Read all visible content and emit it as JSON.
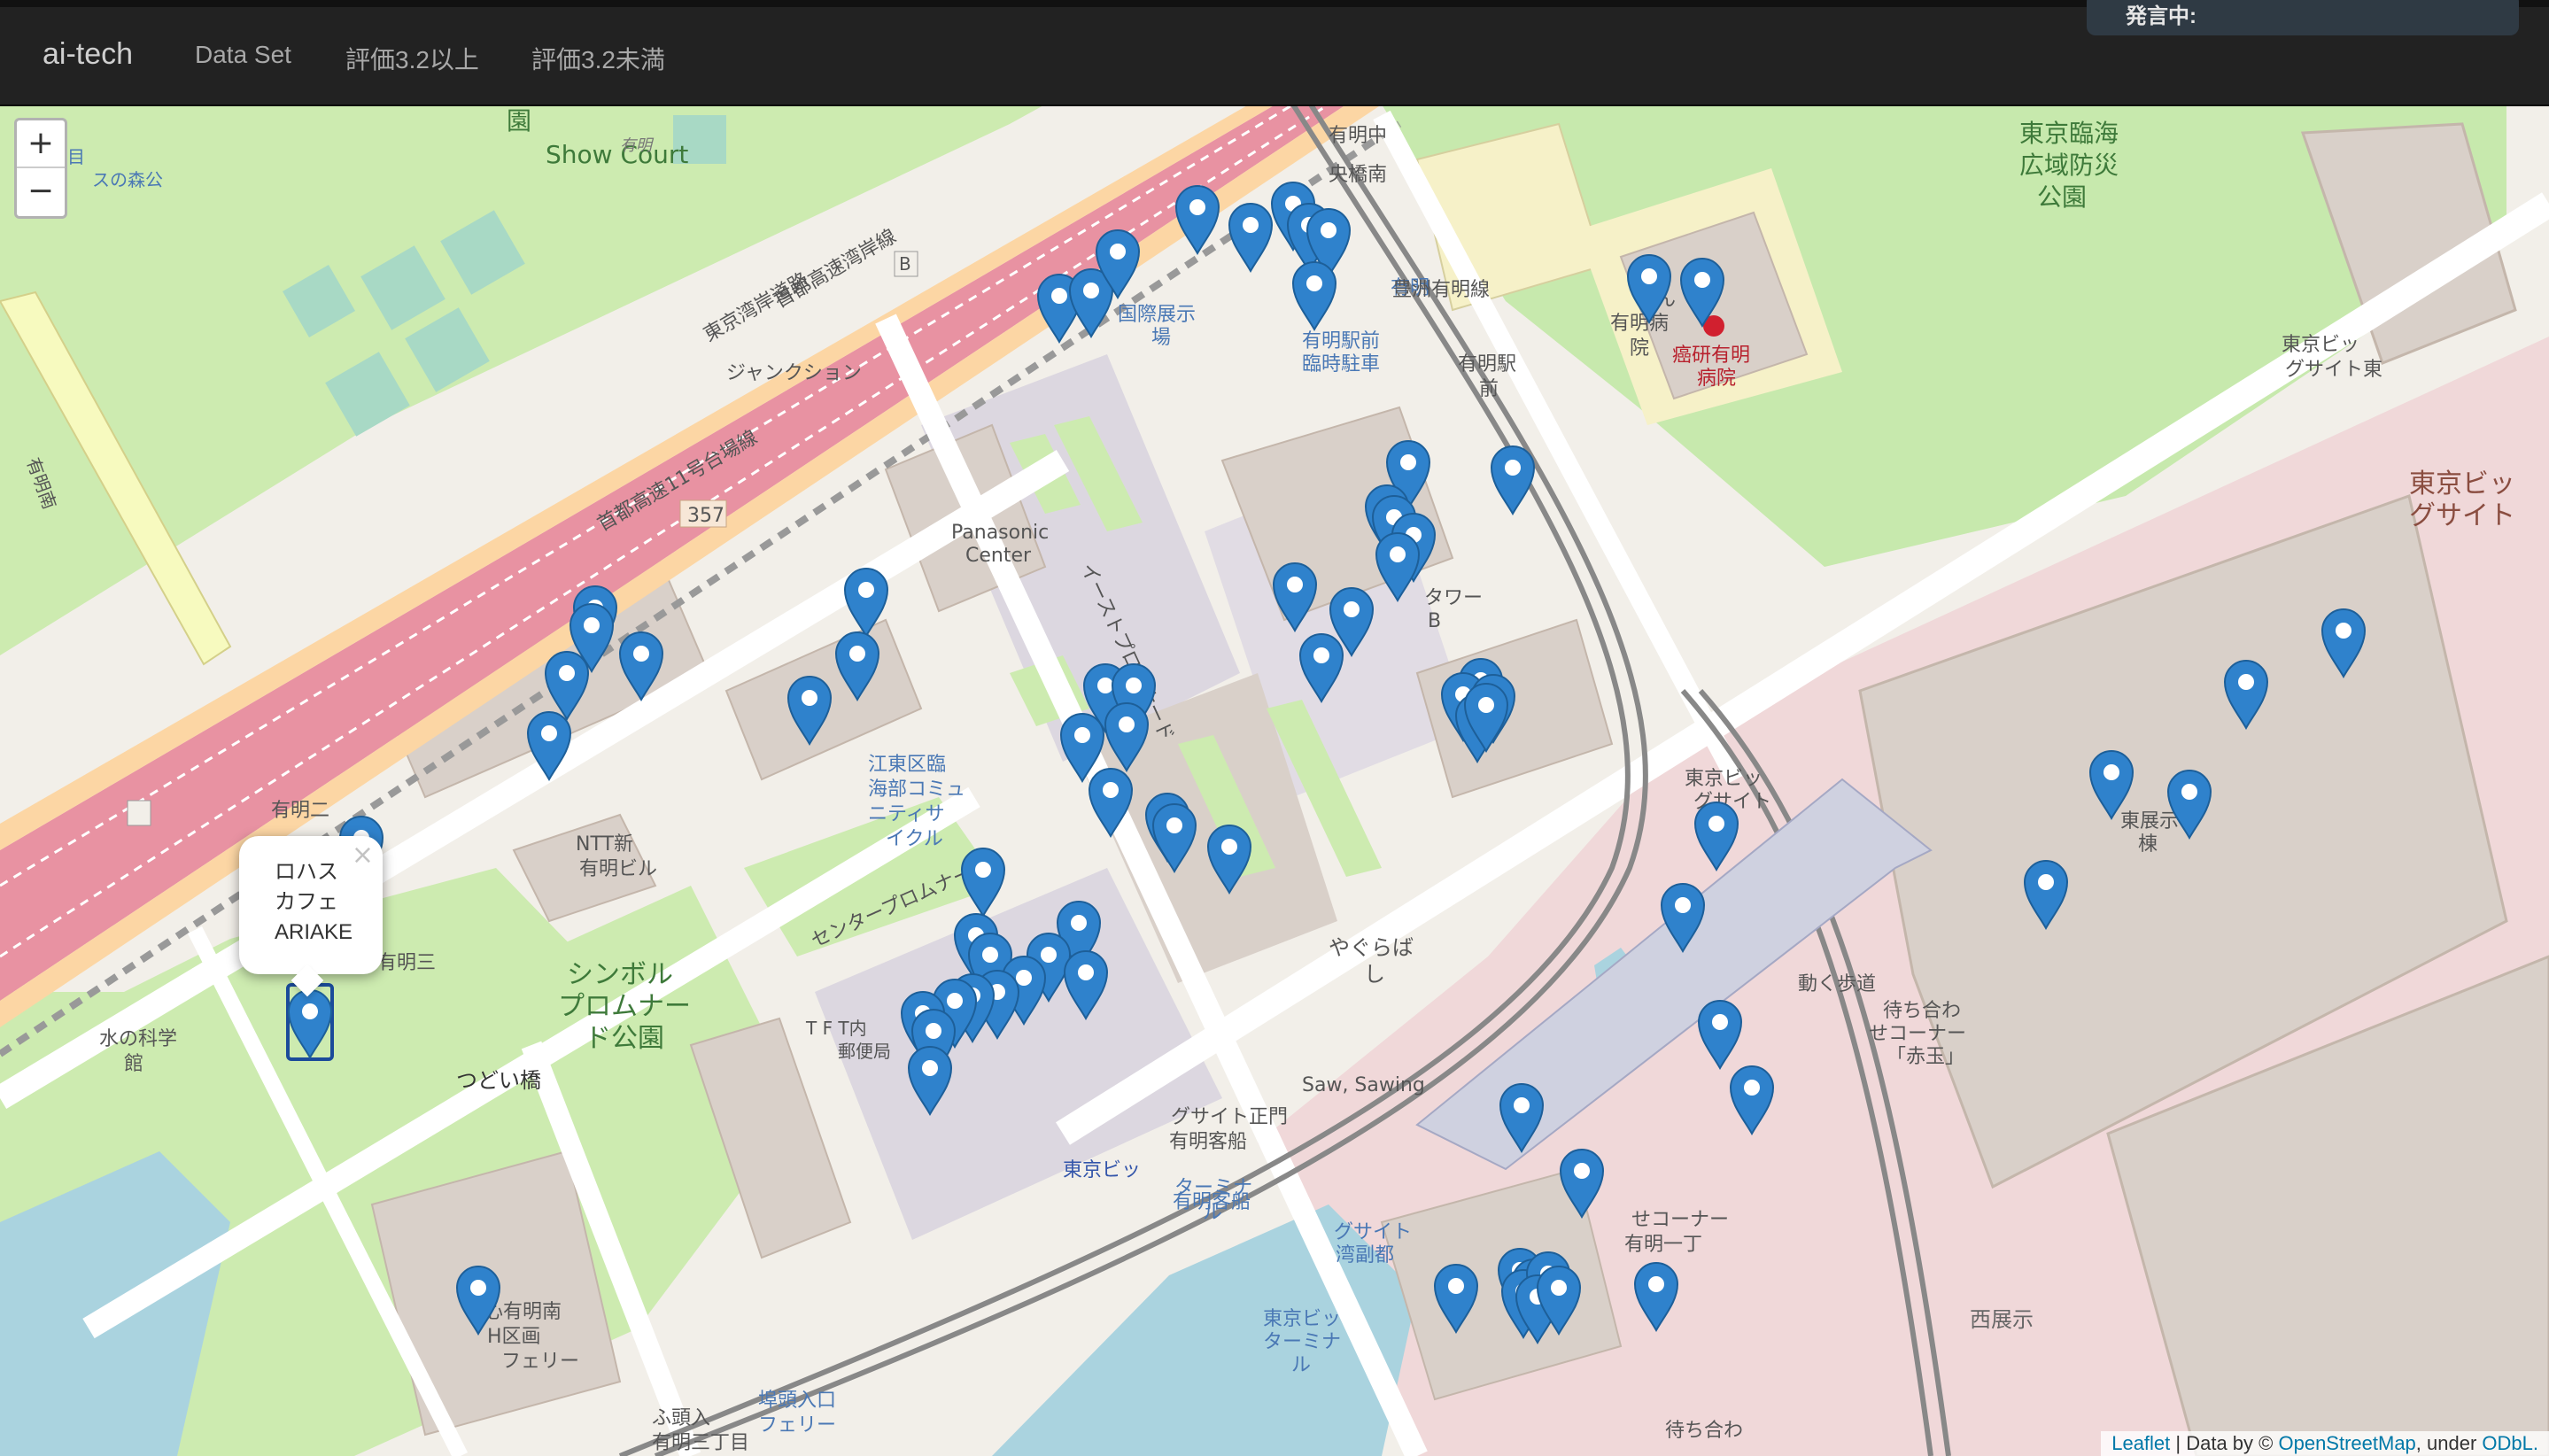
{
  "navbar": {
    "brand": "ai-tech",
    "links": [
      "Data Set",
      "評価3.2以上",
      "評価3.2未満"
    ],
    "status": "発言中:"
  },
  "map": {
    "zoom_in": "+",
    "zoom_out": "−",
    "popup": {
      "line1": "ロハス",
      "line2": "カフェ",
      "line3": "ARIAKE",
      "close": "×"
    },
    "attribution": {
      "leaflet": "Leaflet",
      "sep": " | Data by © ",
      "osm": "OpenStreetMap",
      "under": ", under ",
      "odbl": "ODbL."
    },
    "labels": [
      "東京臨海",
      "広域防災",
      "公園",
      "東京ビッ",
      "グサイト",
      "有明",
      "ジャンクション",
      "東京湾岸道路",
      "首都高速湾岸線",
      "首都高速11号台場線",
      "357",
      "Panasonic",
      "Center",
      "イーストプロムナード",
      "江東区臨",
      "海部コミュ",
      "ニティサ",
      "イクル",
      "センタープロムナード",
      "シンボル",
      "プロムナー",
      "ド公園",
      "つどい橋",
      "有明二",
      "丁目",
      "有明三",
      "NTT新",
      "有明ビル",
      "水の科学",
      "館",
      "国際展示",
      "場",
      "有明駅前",
      "臨時駐車",
      "有明中",
      "央橋南",
      "有明",
      "有明駅",
      "前",
      "がん",
      "有明病",
      "院",
      "癌研有明",
      "病院",
      "東京ビッ",
      "グサイト東",
      "東展示",
      "棟",
      "待ち合わ",
      "せコーナー",
      "「赤玉」",
      "動く歩道",
      "やぐらば",
      "し",
      "Saw, Sawing",
      "東京ビッ",
      "グサイト",
      "ターミナ",
      "ル",
      "有明客船",
      "ターミナ",
      "ル",
      "T F T内",
      "郵便局",
      "東京ビッ",
      "グサイト正門",
      "有明客船",
      "東京ビッ",
      "グサイト",
      "湾副都",
      "心有明南",
      "H区画",
      "フェリー",
      "埠頭入口",
      "フェリー",
      "ふ頭入",
      "有明三丁目",
      "西展示",
      "待ち合わ",
      "せコーナー",
      "有明一丁",
      "目",
      "スの森公",
      "園",
      "Show Court",
      "有明",
      "豊洲有明線",
      "有明南",
      "有明ビ",
      "タワー",
      "B",
      "B"
    ]
  },
  "markers_count": 70
}
